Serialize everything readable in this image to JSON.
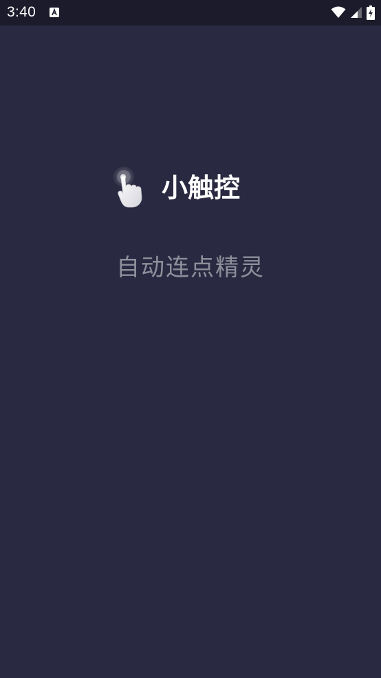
{
  "status_bar": {
    "time": "3:40",
    "icons": [
      "text-notification-icon",
      "wifi-icon",
      "cellular-signal-icon",
      "battery-charging-icon"
    ]
  },
  "splash": {
    "logo_icon": "tap-hand-icon",
    "app_name": "小触控",
    "slogan": "自动连点精灵"
  },
  "colors": {
    "background": "#292941",
    "status_bar": "#1b1b2b",
    "app_name": "#ffffff",
    "slogan": "#8f8f9c"
  }
}
